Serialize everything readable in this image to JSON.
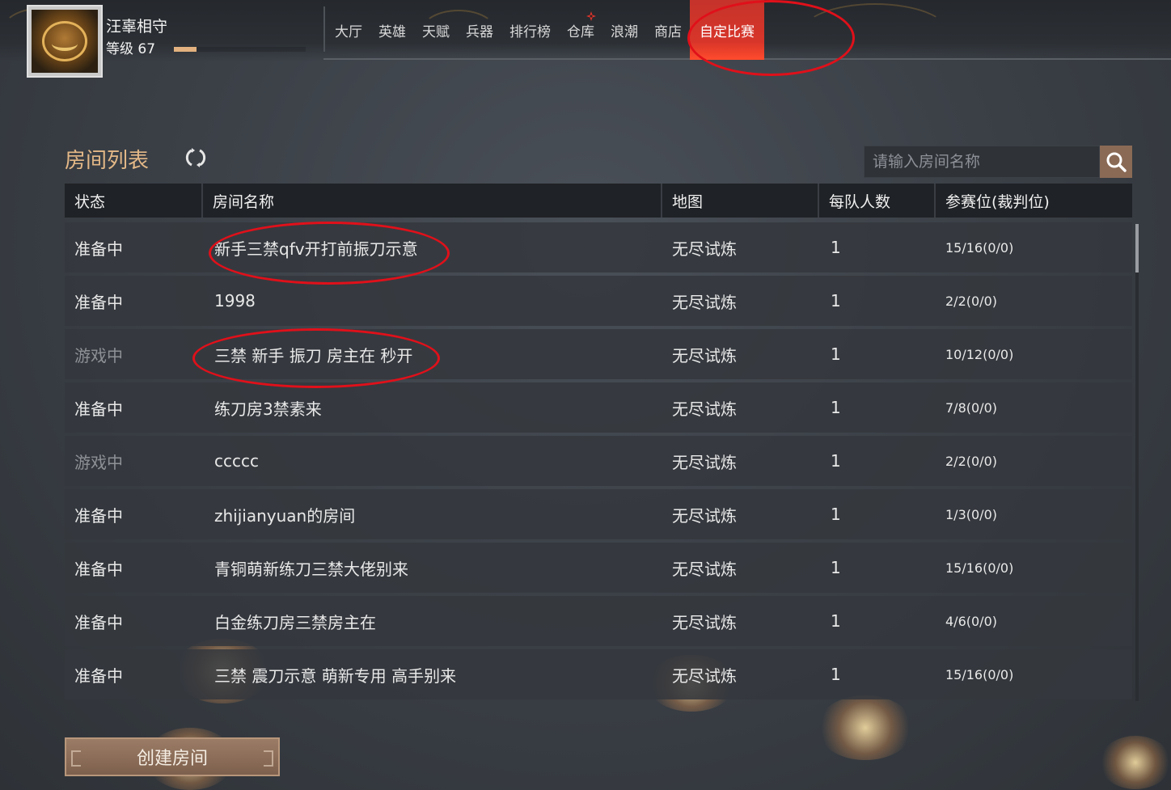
{
  "player": {
    "name": "汪辜相守",
    "level_label": "等级 67",
    "level_progress": 0.17
  },
  "nav": {
    "tabs": [
      {
        "label": "大厅"
      },
      {
        "label": "英雄"
      },
      {
        "label": "天赋"
      },
      {
        "label": "兵器"
      },
      {
        "label": "排行榜"
      },
      {
        "label": "仓库"
      },
      {
        "label": "浪潮"
      },
      {
        "label": "商店"
      },
      {
        "label": "自定比赛"
      }
    ],
    "active_tab": "自定比赛"
  },
  "room_list": {
    "title": "房间列表",
    "search": {
      "placeholder": "请输入房间名称",
      "value": ""
    },
    "columns": [
      "状态",
      "房间名称",
      "地图",
      "每队人数",
      "参赛位(裁判位)"
    ],
    "rows": [
      {
        "status": "准备中",
        "name": "新手三禁qfv开打前振刀示意",
        "map": "无尽试炼",
        "team_size": "1",
        "slots": "15/16(0/0)"
      },
      {
        "status": "准备中",
        "name": "1998",
        "map": "无尽试炼",
        "team_size": "1",
        "slots": "2/2(0/0)"
      },
      {
        "status": "游戏中",
        "name": "三禁 新手 振刀 房主在 秒开",
        "map": "无尽试炼",
        "team_size": "1",
        "slots": "10/12(0/0)"
      },
      {
        "status": "准备中",
        "name": "练刀房3禁素来",
        "map": "无尽试炼",
        "team_size": "1",
        "slots": "7/8(0/0)"
      },
      {
        "status": "游戏中",
        "name": "ccccc",
        "map": "无尽试炼",
        "team_size": "1",
        "slots": "2/2(0/0)"
      },
      {
        "status": "准备中",
        "name": "zhijianyuan的房间",
        "map": "无尽试炼",
        "team_size": "1",
        "slots": "1/3(0/0)"
      },
      {
        "status": "准备中",
        "name": "青铜萌新练刀三禁大佬别来",
        "map": "无尽试炼",
        "team_size": "1",
        "slots": "15/16(0/0)"
      },
      {
        "status": "准备中",
        "name": "白金练刀房三禁房主在",
        "map": "无尽试炼",
        "team_size": "1",
        "slots": "4/6(0/0)"
      },
      {
        "status": "准备中",
        "name": "三禁 震刀示意 萌新专用 高手别来",
        "map": "无尽试炼",
        "team_size": "1",
        "slots": "15/16(0/0)"
      }
    ]
  },
  "create_button": {
    "label": "创建房间"
  },
  "colors": {
    "accent_title": "#e3b887",
    "active_tab": "#d8352a",
    "annotation": "#e0101a",
    "playing_status": "#8e9297"
  },
  "icons": [
    "refresh-icon",
    "search-icon",
    "warehouse-badge-icon",
    "avatar-emblem-icon"
  ]
}
